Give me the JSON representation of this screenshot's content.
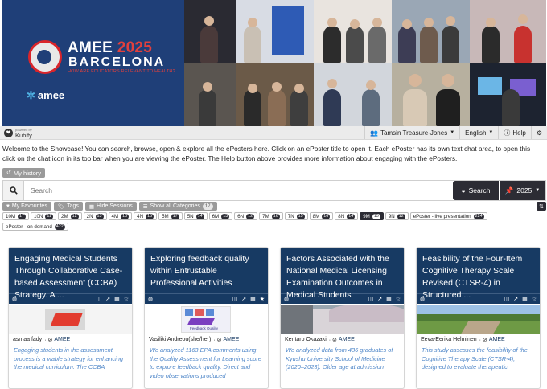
{
  "banner": {
    "title_main": "AMEE",
    "title_year": "2025",
    "title_city": "BARCELONA",
    "tagline": "HOW ARE EDUCATORS RELEVANT TO HEALTH?",
    "org_logo": "amee"
  },
  "topbar": {
    "brand_powered": "powered by",
    "brand": "Kubify",
    "user": "Tamsin Treasure-Jones",
    "language": "English",
    "help": "Help",
    "settings_icon": "gear-icon"
  },
  "welcome": "Welcome to the Showcase! You can search, browse, open & explore all the ePosters here. Click on an ePoster title to open it. Each ePoster has its own text chat area, to open this click on the chat icon in its top bar when you are viewing the ePoster. The Help button above provides more information about engaging with the ePosters.",
  "history_label": "My history",
  "search": {
    "placeholder": "Search",
    "button": "Search",
    "year": "2025"
  },
  "filters": {
    "favourites": "My Favourites",
    "tags": "Tags",
    "hide_sessions": "Hide Sessions",
    "show_all": "Show all Categories",
    "show_all_count": "17"
  },
  "chips": [
    {
      "label": "10M",
      "count": "17",
      "active": false
    },
    {
      "label": "10N",
      "count": "11",
      "active": false
    },
    {
      "label": "2M",
      "count": "12",
      "active": false
    },
    {
      "label": "2N",
      "count": "13",
      "active": false
    },
    {
      "label": "4M",
      "count": "10",
      "active": false
    },
    {
      "label": "4N",
      "count": "15",
      "active": false
    },
    {
      "label": "5M",
      "count": "17",
      "active": false
    },
    {
      "label": "5N",
      "count": "14",
      "active": false
    },
    {
      "label": "6M",
      "count": "13",
      "active": false
    },
    {
      "label": "6N",
      "count": "12",
      "active": false
    },
    {
      "label": "7M",
      "count": "16",
      "active": false
    },
    {
      "label": "7N",
      "count": "15",
      "active": false
    },
    {
      "label": "8M",
      "count": "16",
      "active": false
    },
    {
      "label": "8N",
      "count": "14",
      "active": false
    },
    {
      "label": "9M",
      "count": "15",
      "active": true
    },
    {
      "label": "9N",
      "count": "12",
      "active": false
    },
    {
      "label": "ePoster - live presentation",
      "count": "224",
      "active": false
    },
    {
      "label": "ePoster - on demand",
      "count": "422",
      "active": false
    }
  ],
  "cards": [
    {
      "title": "Engaging Medical Students Through Collaborative Case-based Assessment (CCBA) Strategy. A ...",
      "author": "asmaa fady",
      "org": "AMEE",
      "abstract": "Engaging students in the assessment process is a viable strategy for enhancing the medical curriculum. The CCBA"
    },
    {
      "title": "Exploring feedback quality within Entrustable Professional Activities",
      "author": "Vasiliki Andreou(she/her)",
      "org": "AMEE",
      "thumb_caption": "Feedback Quality",
      "abstract": "We analyzed 1163 EPA comments using the Quality Assessment for Learning score to explore feedback quality. Direct and video observations produced"
    },
    {
      "title": "Factors Associated with the National Medical Licensing Examination Outcomes in Medical Students",
      "author": "Kentaro Okazaki",
      "org": "AMEE",
      "abstract": "We analyzed data from 436 graduates of Kyushu University School of Medicine (2020–2023). Older age at admission"
    },
    {
      "title": "Feasibility of the Four-Item Cognitive Therapy Scale Revised (CTSR-4) in Structured ...",
      "author": "Eeva-Eerika Helminen",
      "org": "AMEE",
      "abstract": "This study assesses the feasibility of the Cognitive Therapy Scale (CTSR-4), designed to evaluate therapeutic"
    }
  ]
}
